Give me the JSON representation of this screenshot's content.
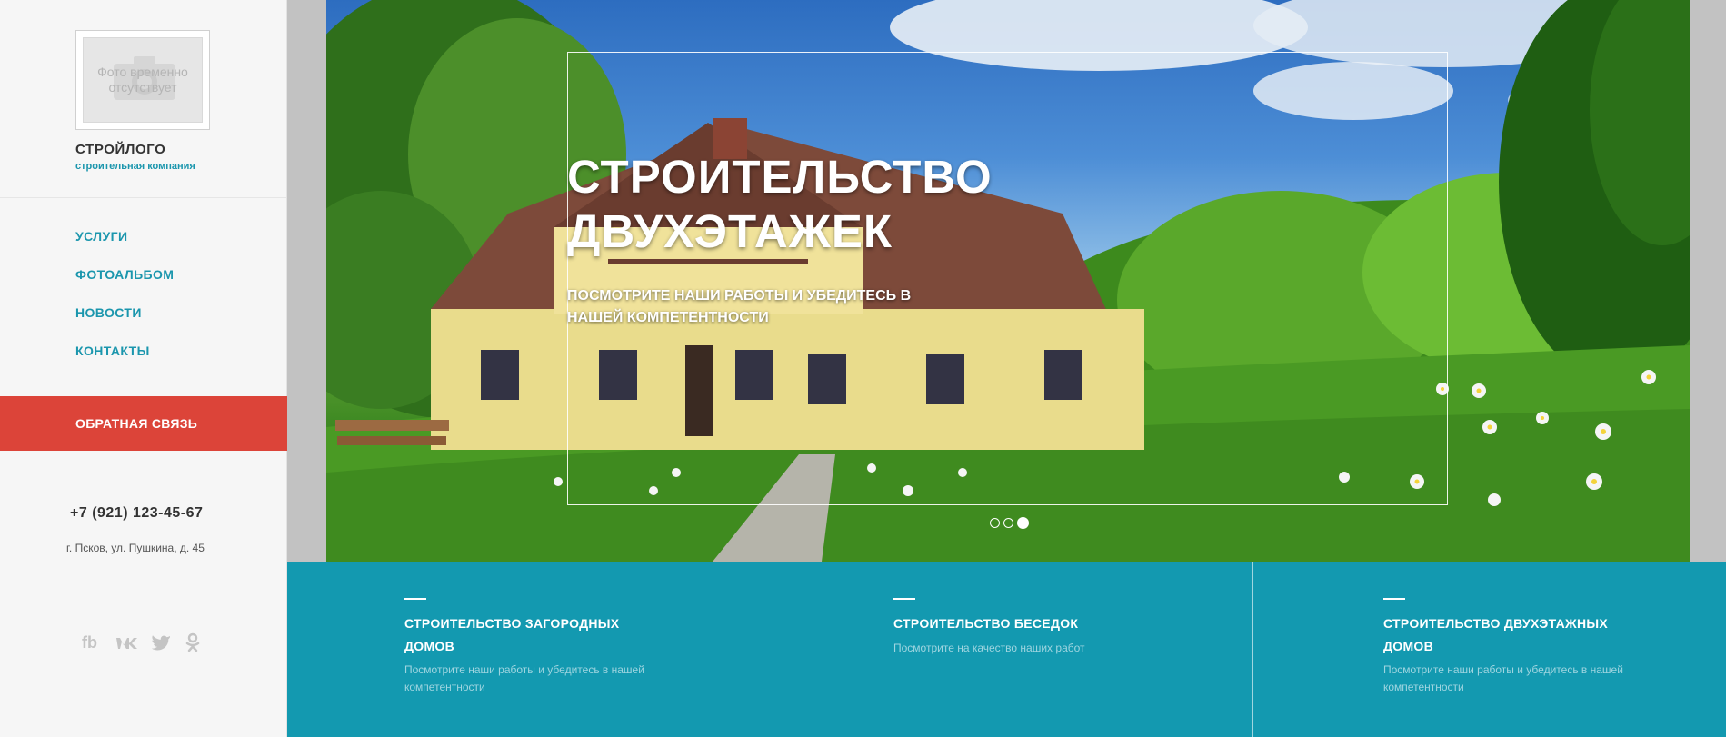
{
  "sidebar": {
    "logo_placeholder": "Фото временно отсутствует",
    "company_name": "СТРОЙЛОГО",
    "company_tagline": "строительная компания",
    "nav": [
      {
        "label": "УСЛУГИ"
      },
      {
        "label": "ФОТОАЛЬБОМ"
      },
      {
        "label": "НОВОСТИ"
      },
      {
        "label": "КОНТАКТЫ"
      }
    ],
    "feedback_label": "ОБРАТНАЯ СВЯЗЬ",
    "phone": "+7 (921) 123-45-67",
    "address": "г. Псков, ул. Пушкина, д. 45",
    "socials": [
      "facebook-icon",
      "vk-icon",
      "twitter-icon",
      "odnoklassniki-icon"
    ],
    "accent_color": "#1b96ad",
    "feedback_color": "#dc4439"
  },
  "hero": {
    "title_line1": "СТРОИТЕЛЬСТВО",
    "title_line2": "ДВУХЭТАЖЕК",
    "subtitle": "ПОСМОТРИТЕ НАШИ РАБОТЫ И УБЕДИТЕСЬ В НАШЕЙ КОМПЕТЕНТНОСТИ",
    "slides_total": 3,
    "active_slide": 3
  },
  "features": {
    "background_color": "#1399b0",
    "items": [
      {
        "title": "СТРОИТЕЛЬСТВО ЗАГОРОДНЫХ ДОМОВ",
        "text": "Посмотрите наши работы и убедитесь в нашей компетентности"
      },
      {
        "title": "СТРОИТЕЛЬСТВО БЕСЕДОК",
        "text": "Посмотрите на качество наших работ"
      },
      {
        "title": "СТРОИТЕЛЬСТВО ДВУХЭТАЖНЫХ ДОМОВ",
        "text": "Посмотрите наши работы и убедитесь в нашей компетентности"
      }
    ]
  }
}
